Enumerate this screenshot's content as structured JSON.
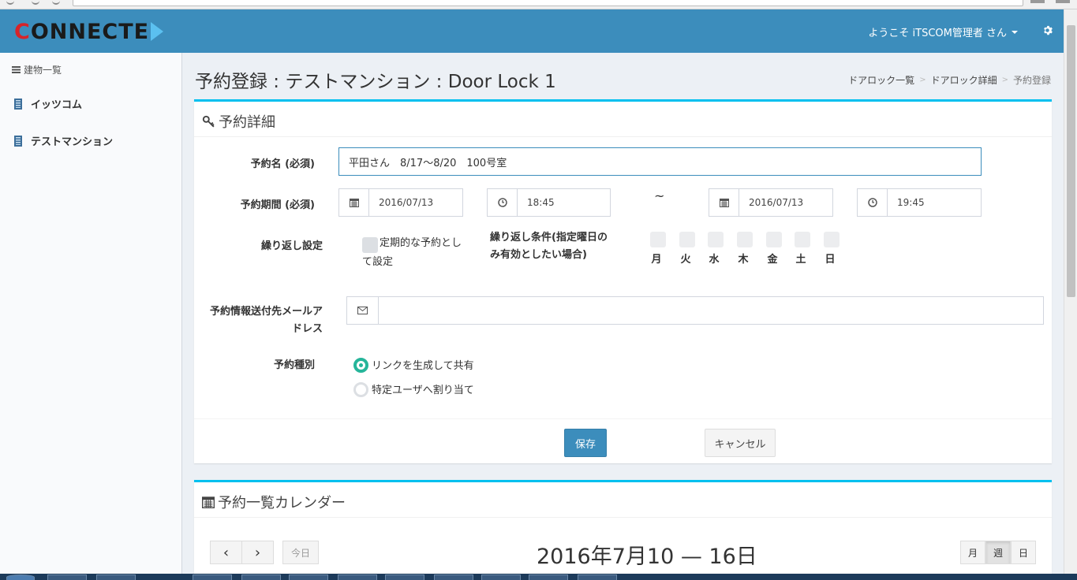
{
  "header": {
    "logo_text_c": "C",
    "logo_text_rest": "ONNECTE",
    "user_greeting": "ようこそ iTSCOM管理者 さん"
  },
  "sidebar": {
    "heading": "建物一覧",
    "items": [
      {
        "label": "イッツコム"
      },
      {
        "label": "テストマンション"
      }
    ]
  },
  "page": {
    "title": "予約登録 : テストマンション : Door Lock 1",
    "breadcrumb": [
      "ドアロック一覧",
      "ドアロック詳細",
      "予約登録"
    ]
  },
  "form": {
    "box_title": "予約詳細",
    "reservation_name_label": "予約名 (必須)",
    "reservation_name_value": "平田さん　8/17〜8/20　100号室",
    "period_label": "予約期間 (必須)",
    "start_date": "2016/07/13",
    "start_time": "18:45",
    "tilde": "~",
    "end_date": "2016/07/13",
    "end_time": "19:45",
    "repeat_label": "繰り返し設定",
    "repeat_checkbox_label_1": "定期的な予約とし",
    "repeat_checkbox_label_2": "て設定",
    "repeat_condition_label_1": "繰り返し条件(指定曜日の",
    "repeat_condition_label_2": "み有効としたい場合)",
    "days": [
      "月",
      "火",
      "水",
      "木",
      "金",
      "土",
      "日"
    ],
    "email_label_1": "予約情報送付先メールア",
    "email_label_2": "ドレス",
    "email_value": "",
    "type_label": "予約種別",
    "type_options": [
      {
        "label": "リンクを生成して共有",
        "selected": true
      },
      {
        "label": "特定ユーザへ割り当て",
        "selected": false
      }
    ],
    "save_label": "保存",
    "cancel_label": "キャンセル"
  },
  "calendar": {
    "box_title": "予約一覧カレンダー",
    "prev": "‹",
    "next": "›",
    "today_label": "今日",
    "title": "2016年7月10 — 16日",
    "views": [
      "月",
      "週",
      "日"
    ],
    "active_view": "週"
  },
  "colors": {
    "header": "#3c8dbc",
    "box_accent": "#00c0ef",
    "primary_button": "#3c8dbc",
    "radio_selected": "#26b59a"
  }
}
